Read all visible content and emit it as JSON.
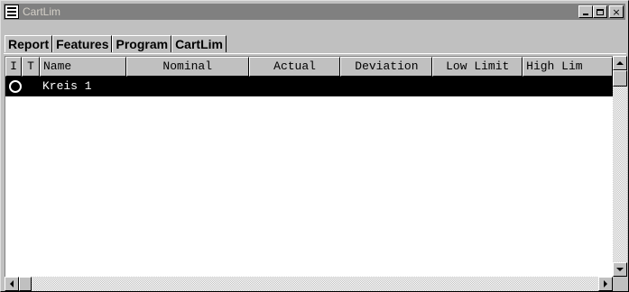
{
  "window": {
    "title": "CartLim",
    "controls": {
      "close_label": "×"
    }
  },
  "tabs": [
    {
      "label": "Report"
    },
    {
      "label": "Features"
    },
    {
      "label": "Program"
    },
    {
      "label": "CartLim"
    }
  ],
  "table": {
    "columns": [
      "I",
      "T",
      "Name",
      "Nominal",
      "Actual",
      "Deviation",
      "Low Limit",
      "High Lim"
    ],
    "rows": [
      {
        "status_icon": "circle-icon",
        "t": "",
        "name": "Kreis 1",
        "nominal": "",
        "actual": "",
        "deviation": "",
        "low_limit": "",
        "high_limit": ""
      }
    ]
  },
  "colors": {
    "titlebar": "#808080",
    "selection": "#000000",
    "face": "#c0c0c0"
  }
}
